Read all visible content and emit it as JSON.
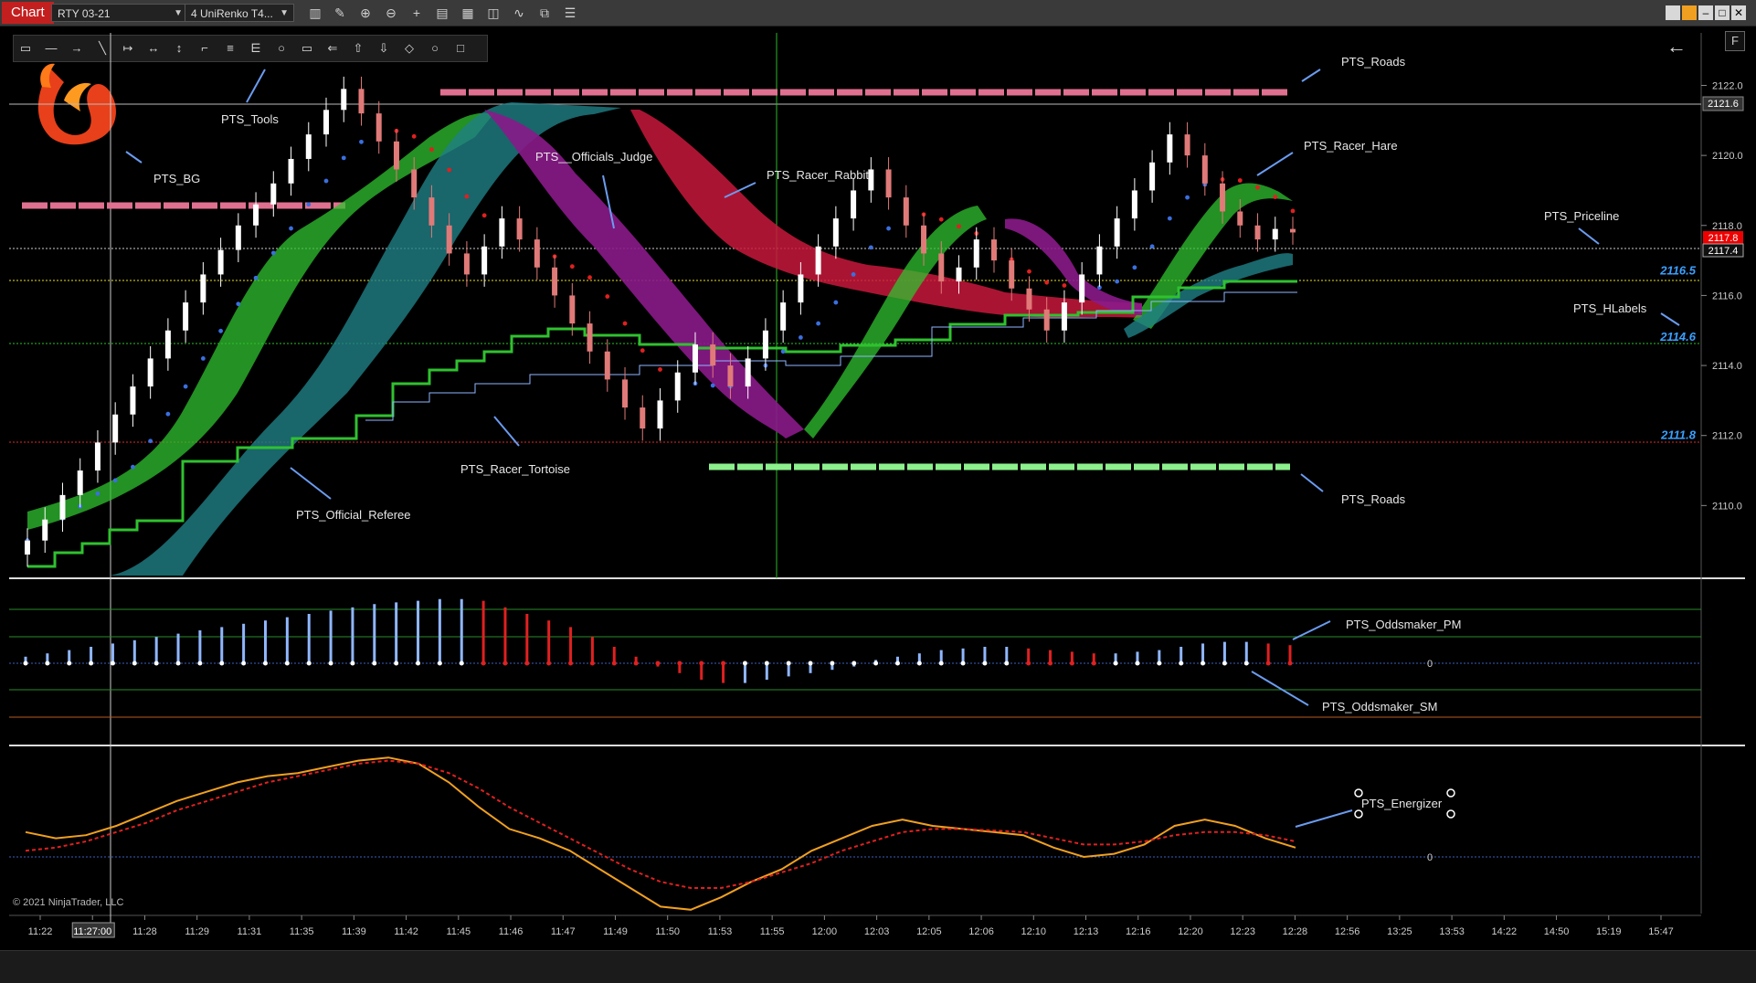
{
  "window": {
    "chart_tab": "Chart",
    "instrument": "RTY 03-21",
    "bar_type": "4 UniRenko T4...",
    "float_button": "F",
    "copyright": "© 2021 NinjaTrader, LLC"
  },
  "toolbar_icons": [
    "bars-style-icon",
    "draw-pencil-icon",
    "zoom-in-icon",
    "zoom-out-icon",
    "crosshair-icon",
    "properties-icon",
    "templates-icon",
    "snapshot-icon",
    "indicators-icon",
    "strategies-icon",
    "data-box-icon"
  ],
  "drawing_tools": [
    "ruler-icon",
    "line-icon",
    "arrow-line-icon",
    "extended-line-icon",
    "ray-icon",
    "horizontal-line-icon",
    "vertical-line-icon",
    "polyline-icon",
    "fib-retracement-icon",
    "fib-extension-icon",
    "ellipse-icon",
    "rectangle-icon",
    "path-icon",
    "arrow-up-icon",
    "arrow-down-icon",
    "diamond-icon",
    "circle-icon",
    "square-icon"
  ],
  "annotations": {
    "roads_top": "PTS_Roads",
    "tools": "PTS_Tools",
    "bg": "PTS_BG",
    "officials_judge": "PTS__Officials_Judge",
    "racer_rabbit": "PTS_Racer_Rabbit",
    "racer_hare": "PTS_Racer_Hare",
    "priceline": "PTS_Priceline",
    "hlabels": "PTS_HLabels",
    "racer_tortoise": "PTS_Racer_Tortoise",
    "official_referee": "PTS_Official_Referee",
    "roads_bottom": "PTS_Roads",
    "oddsmaker_pm": "PTS_Oddsmaker_PM",
    "oddsmaker_sm": "PTS_Oddsmaker_SM",
    "energizer": "PTS_Energizer"
  },
  "hlabels": [
    "2116.5",
    "2114.6",
    "2111.8"
  ],
  "price_badges": {
    "crosshair": "2121.6",
    "last": "2117.8",
    "bid": "2117.4"
  },
  "colors": {
    "bg": "#000000",
    "bull_bar": "#ffffff",
    "bear_bar": "#e07a78",
    "green_band": "#2fc12f",
    "teal_band": "#1f7f86",
    "red_band": "#c8183c",
    "purple_band": "#8a1a8a",
    "roads_pink": "#e07090",
    "roads_green": "#8cf08c",
    "label_blue": "#3aa0ff",
    "energizer_orange": "#f0a020",
    "energizer_red": "#e02020"
  },
  "chart_data": [
    {
      "type": "line",
      "title": "",
      "instrument": "RTY 03-21",
      "y_ticks": [
        "2122.0",
        "2120.0",
        "2118.0",
        "2116.0",
        "2114.0",
        "2112.0",
        "2110.0"
      ],
      "ylim": [
        2108.0,
        2123.5
      ],
      "x_ticks": [
        "11:22",
        "11:27:00",
        "11:28",
        "11:29",
        "11:31",
        "11:35",
        "11:39",
        "11:42",
        "11:45",
        "11:46",
        "11:47",
        "11:49",
        "11:50",
        "11:53",
        "11:55",
        "12:00",
        "12:03",
        "12:05",
        "12:06",
        "12:10",
        "12:13",
        "12:16",
        "12:20",
        "12:23",
        "12:28",
        "12:56",
        "13:25",
        "13:53",
        "14:22",
        "14:50",
        "15:19",
        "15:47"
      ],
      "series": [
        {
          "values": [
            2109.0,
            2109.6,
            2110.3,
            2111.0,
            2111.8,
            2112.6,
            2113.4,
            2114.2,
            2115.0,
            2115.8,
            2116.6,
            2117.3,
            2118.0,
            2118.6,
            2119.2,
            2119.9,
            2120.6,
            2121.3,
            2121.9,
            2121.2,
            2120.4,
            2119.6,
            2118.8,
            2118.0,
            2117.2,
            2116.6,
            2117.4,
            2118.2,
            2117.6,
            2116.8,
            2116.0,
            2115.2,
            2114.4,
            2113.6,
            2112.8,
            2112.2,
            2113.0,
            2113.8,
            2114.6,
            2114.0,
            2113.4,
            2114.2,
            2115.0,
            2115.8,
            2116.6,
            2117.4,
            2118.2,
            2119.0,
            2119.6,
            2118.8,
            2118.0,
            2117.2,
            2116.4,
            2116.8,
            2117.6,
            2117.0,
            2116.2,
            2115.6,
            2115.0,
            2115.8,
            2116.6,
            2117.4,
            2118.2,
            2119.0,
            2119.8,
            2120.6,
            2120.0,
            2119.2,
            2118.4,
            2118.0,
            2117.6,
            2117.9,
            2117.8
          ]
        }
      ]
    },
    {
      "type": "bar",
      "title": "",
      "y_ticks": [
        "0"
      ],
      "series": [
        {
          "values": [
            0.2,
            0.3,
            0.4,
            0.5,
            0.6,
            0.7,
            0.8,
            0.9,
            1.0,
            1.1,
            1.2,
            1.3,
            1.4,
            1.5,
            1.6,
            1.7,
            1.8,
            1.85,
            1.9,
            1.95,
            1.95,
            1.9,
            1.7,
            1.5,
            1.3,
            1.1,
            0.8,
            0.5,
            0.2,
            -0.1,
            -0.3,
            -0.5,
            -0.6,
            -0.6,
            -0.5,
            -0.4,
            -0.3,
            -0.2,
            -0.1,
            0.1,
            0.2,
            0.3,
            0.4,
            0.45,
            0.5,
            0.5,
            0.45,
            0.4,
            0.35,
            0.3,
            0.3,
            0.35,
            0.4,
            0.5,
            0.6,
            0.65,
            0.65,
            0.6,
            0.55
          ]
        }
      ]
    },
    {
      "type": "line",
      "title": "",
      "y_ticks": [
        "0"
      ],
      "series": [
        {
          "values": [
            0.8,
            0.6,
            0.7,
            1.0,
            1.4,
            1.8,
            2.1,
            2.4,
            2.6,
            2.7,
            2.9,
            3.1,
            3.2,
            3.0,
            2.4,
            1.6,
            0.9,
            0.6,
            0.2,
            -0.4,
            -1.0,
            -1.6,
            -1.7,
            -1.3,
            -0.8,
            -0.4,
            0.2,
            0.6,
            1.0,
            1.2,
            1.0,
            0.9,
            0.8,
            0.7,
            0.3,
            0.0,
            0.1,
            0.4,
            1.0,
            1.2,
            1.0,
            0.6,
            0.3
          ]
        },
        {
          "values": [
            0.2,
            0.3,
            0.5,
            0.8,
            1.1,
            1.5,
            1.8,
            2.1,
            2.4,
            2.6,
            2.8,
            3.0,
            3.1,
            3.0,
            2.7,
            2.2,
            1.6,
            1.1,
            0.6,
            0.1,
            -0.4,
            -0.8,
            -1.0,
            -1.0,
            -0.8,
            -0.5,
            -0.2,
            0.2,
            0.5,
            0.8,
            0.9,
            0.9,
            0.85,
            0.8,
            0.6,
            0.4,
            0.4,
            0.5,
            0.7,
            0.8,
            0.8,
            0.7,
            0.5
          ]
        }
      ]
    }
  ]
}
